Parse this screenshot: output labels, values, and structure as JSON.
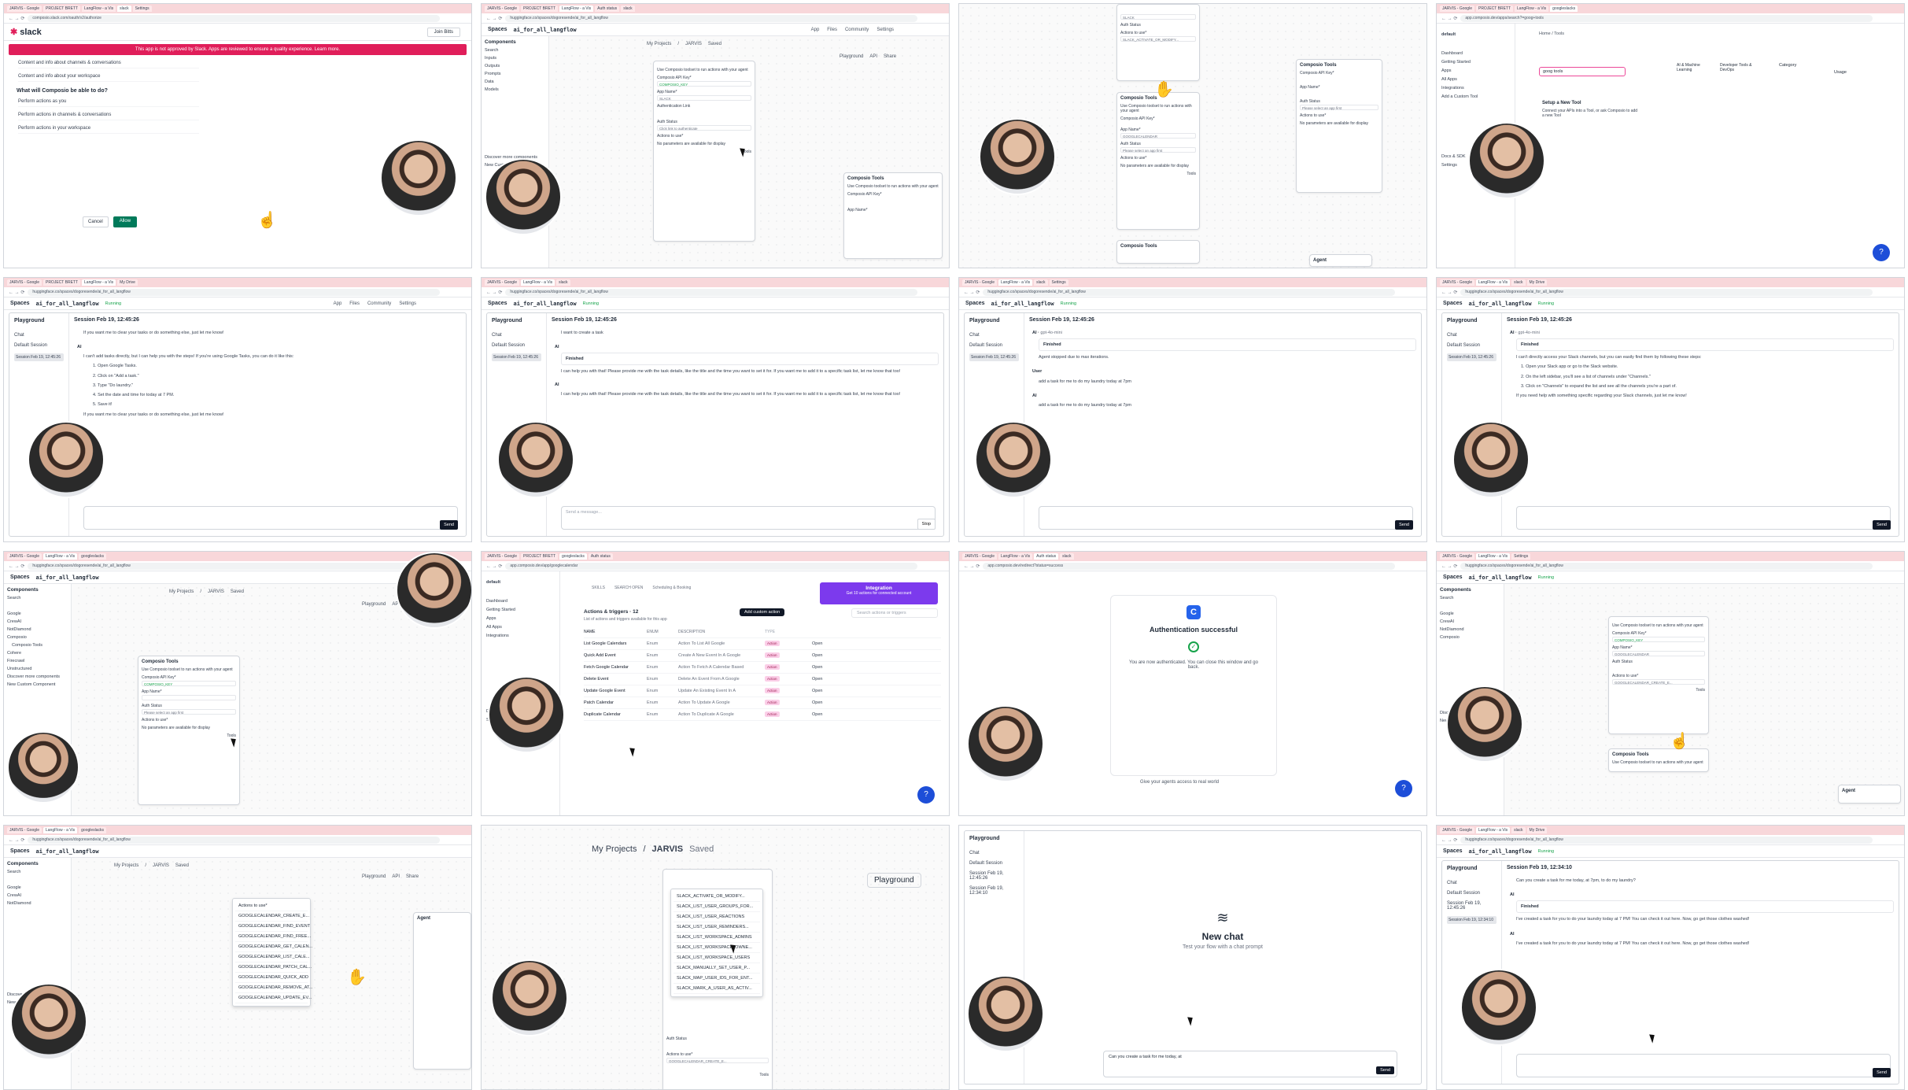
{
  "tabs": [
    "JARVIS - Google",
    "PROJECT BRETT",
    "LangFlow - a Vis",
    "googleslacks",
    "Auth status",
    "slack",
    "Settings",
    "My Drive"
  ],
  "urls": {
    "slack": "composio.slack.com/oauth/v2/authorize",
    "langflow": "huggingface.co/spaces/dogoresende/ai_for_all_langflow",
    "composio_tools": "app.composio.dev/apps/search?=goog+tools",
    "composio_gcal": "app.composio.dev/app/googlecalendar",
    "composio_auth": "app.composio.dev/redirect?status=success"
  },
  "langflow": {
    "brand": "Spaces",
    "flow_name": "ai_for_all_langflow",
    "running": "Running",
    "nav": [
      "App",
      "Files",
      "Community",
      "Settings"
    ],
    "breadcrumb_projects": "My Projects",
    "breadcrumb_flow": "JARVIS",
    "saved": "Saved",
    "playground": "Playground",
    "api": "API",
    "share": "Share",
    "components_title": "Components",
    "search": "Search",
    "discover": "Discover more components",
    "new_custom": "New Custom Component"
  },
  "slack": {
    "brand": "slack",
    "workspace": "Join Bitts",
    "warning": "This app is not approved by Slack. Apps are reviewed to ensure a quality experience. Learn more.",
    "perms_top": [
      "Content and info about channels & conversations",
      "Content and info about your workspace"
    ],
    "question": "What will Composio be able to do?",
    "perms_do": [
      "Perform actions as you",
      "Perform actions in channels & conversations",
      "Perform actions in your workspace"
    ],
    "cancel": "Cancel",
    "allow": "Allow"
  },
  "composio_node": {
    "title": "Composio Tools",
    "desc": "Use Composio toolset to run actions with your agent",
    "api_key_label": "Composio API Key*",
    "api_key_value": "COMPOSIO_KEY",
    "app_name_label": "App Name*",
    "app_slack": "SLACK",
    "app_gcal": "GOOGLECALENDAR",
    "auth_link": "Authentication Link",
    "auth_status": "Auth Status",
    "auth_click": "Click link to authenticate",
    "select_app": "Please select an app first",
    "actions_label": "Actions to use*",
    "no_params": "No parameters are available for display",
    "tools": "Tools",
    "slack_action": "SLACK_ACTIVATE_OR_MODIFY...",
    "gcal_action": "GOOGLECALENDAR_CREATE_E..."
  },
  "composio_tools_page": {
    "default": "default",
    "search_value": "goog tools",
    "home": "Home",
    "tools_crumb": "Tools",
    "setup_title": "Setup a New Tool",
    "setup_desc": "Connect your APIs into a Tool, or ask Composio to add a new Tool",
    "side": [
      "Dashboard",
      "Getting Started",
      "Apps",
      "All Apps",
      "Integrations",
      "Add a Custom Tool",
      "Docs & SDK",
      "Settings"
    ],
    "cat1": "AI & Machine Learning",
    "cat2": "Developer Tools & DevOps",
    "category": "Category",
    "usage": "Usage"
  },
  "gcal": {
    "tabs": [
      "SKILLS",
      "SEARCH OPEN",
      "Scheduling & Booking"
    ],
    "header": "Actions & triggers · 12",
    "sub": "List of actions and triggers available for this app",
    "add_action": "Add custom action",
    "search": "Search actions or triggers",
    "cols": [
      "NAME",
      "ENUM",
      "DESCRIPTION",
      "TYPE"
    ],
    "rows": [
      [
        "List Google Calendars",
        "Enum",
        "Action To List All Google",
        "Action",
        "Open"
      ],
      [
        "Quick Add Event",
        "Enum",
        "Create A New Event In A Google",
        "Action",
        "Open"
      ],
      [
        "Fetch Google Calendar",
        "Enum",
        "Action To Fetch A Calendar Based",
        "Action",
        "Open"
      ],
      [
        "Delete Event",
        "Enum",
        "Delete An Event From A Google",
        "Action",
        "Open"
      ],
      [
        "Update Google Event",
        "Enum",
        "Update An Existing Event In A",
        "Action",
        "Open"
      ],
      [
        "Patch Calendar",
        "Enum",
        "Action To Update A Google",
        "Action",
        "Open"
      ],
      [
        "Duplicate Calendar",
        "Enum",
        "Action To Duplicate A Google",
        "Action",
        "Open"
      ]
    ],
    "integration": "Integration",
    "integration_sub": "Get 10 actions for connected account"
  },
  "auth": {
    "title": "Authentication successful",
    "desc": "You are now authenticated. You can close this window and go back.",
    "foot": "Give your agents access to real world"
  },
  "playground": {
    "title": "Playground",
    "chat": "Chat",
    "default_session": "Default Session",
    "session": "Session Feb 19, 12:45:26",
    "session2": "Session Feb 19, 12:34:10",
    "send": "Send",
    "stop": "Stop",
    "placeholder": "Send a message...",
    "ai": "AI",
    "user": "User",
    "finished": "Finished",
    "model": "gpt-4o-mini",
    "p1_top": "If you want me to clear your tasks or do something else, just let me know!",
    "p1_body": "I can't add tasks directly, but I can help you with the steps! If you're using Google Tasks, you can do it like this:",
    "p1_steps": [
      "1. Open Google Tasks.",
      "2. Click on \"Add a task.\"",
      "3. Type \"Do laundry.\"",
      "4. Set the date and time for today at 7 PM.",
      "5. Save it!"
    ],
    "p1_end": "If you want me to clear your tasks or do something else, just let me know!",
    "p2_user": "I want to create a task",
    "p2_ai": "I can help you with that! Please provide me with the task details, like the title and the time you want to set it for. If you want me to add it to a specific task list, let me know that too!",
    "p3_ai": "Agent stopped due to max iterations.",
    "p3_user": "add a task for me to do my laundry today at 7pm",
    "p4_ai": "I can't directly access your Slack channels, but you can easily find them by following these steps:",
    "p4_steps": [
      "1. Open your Slack app or go to the Slack website.",
      "2. On the left sidebar, you'll see a list of channels under \"Channels.\"",
      "3. Click on \"Channels\" to expand the list and see all the channels you're a part of."
    ],
    "p4_end": "If you need help with something specific regarding your Slack channels, just let me know!",
    "new_chat": "New chat",
    "new_chat_sub": "Test your flow with a chat prompt",
    "typed": "Can you create a task for me today, at",
    "p16_user": "Can you create a task for me today, at 7pm, to do my laundry?",
    "p16_ai": "I've created a task for you to do your laundry today at 7 PM! You can check it out here. Now, go get those clothes washed!"
  },
  "dropdown_actions": [
    "SLACK_ACTIVATE_OR_MODIFY...",
    "SLACK_LIST_USER_GROUPS_FOR...",
    "SLACK_LIST_USER_REACTIONS",
    "SLACK_LIST_USER_REMINDERS...",
    "SLACK_LIST_WORKSPACE_ADMINS",
    "SLACK_LIST_WORKSPACE_OWNE...",
    "SLACK_LIST_WORKSPACE_USERS",
    "SLACK_MANUALLY_SET_USER_P...",
    "SLACK_MAP_USER_IDS_FOR_ENT...",
    "SLACK_MARK_A_USER_AS_ACTIV..."
  ],
  "dropdown_gcal": [
    "GOOGLECALENDAR_CREATE_E...",
    "GOOGLECALENDAR_FIND_EVENT",
    "GOOGLECALENDAR_FIND_FREE...",
    "GOOGLECALENDAR_GET_CALEN...",
    "GOOGLECALENDAR_LIST_CALE...",
    "GOOGLECALENDAR_PATCH_CAL...",
    "GOOGLECALENDAR_QUICK_ADD",
    "GOOGLECALENDAR_REMOVE_AT...",
    "GOOGLECALENDAR_UPDATE_EV..."
  ],
  "side_components": [
    "Inputs",
    "Outputs",
    "Prompts",
    "Data",
    "Models",
    "Vector Stores",
    "Embeddings",
    "Agents"
  ],
  "side_providers": [
    "Google",
    "CrewAI",
    "NotDiamond",
    "Composio",
    "Composio Tools",
    "Cohere",
    "Firecrawl",
    "Unstructured"
  ],
  "agent": "Agent",
  "colors": {
    "slack_red": "#e01e5a",
    "allow_green": "#007a5a",
    "composio_blue": "#2563eb",
    "running_green": "#16a34a"
  }
}
